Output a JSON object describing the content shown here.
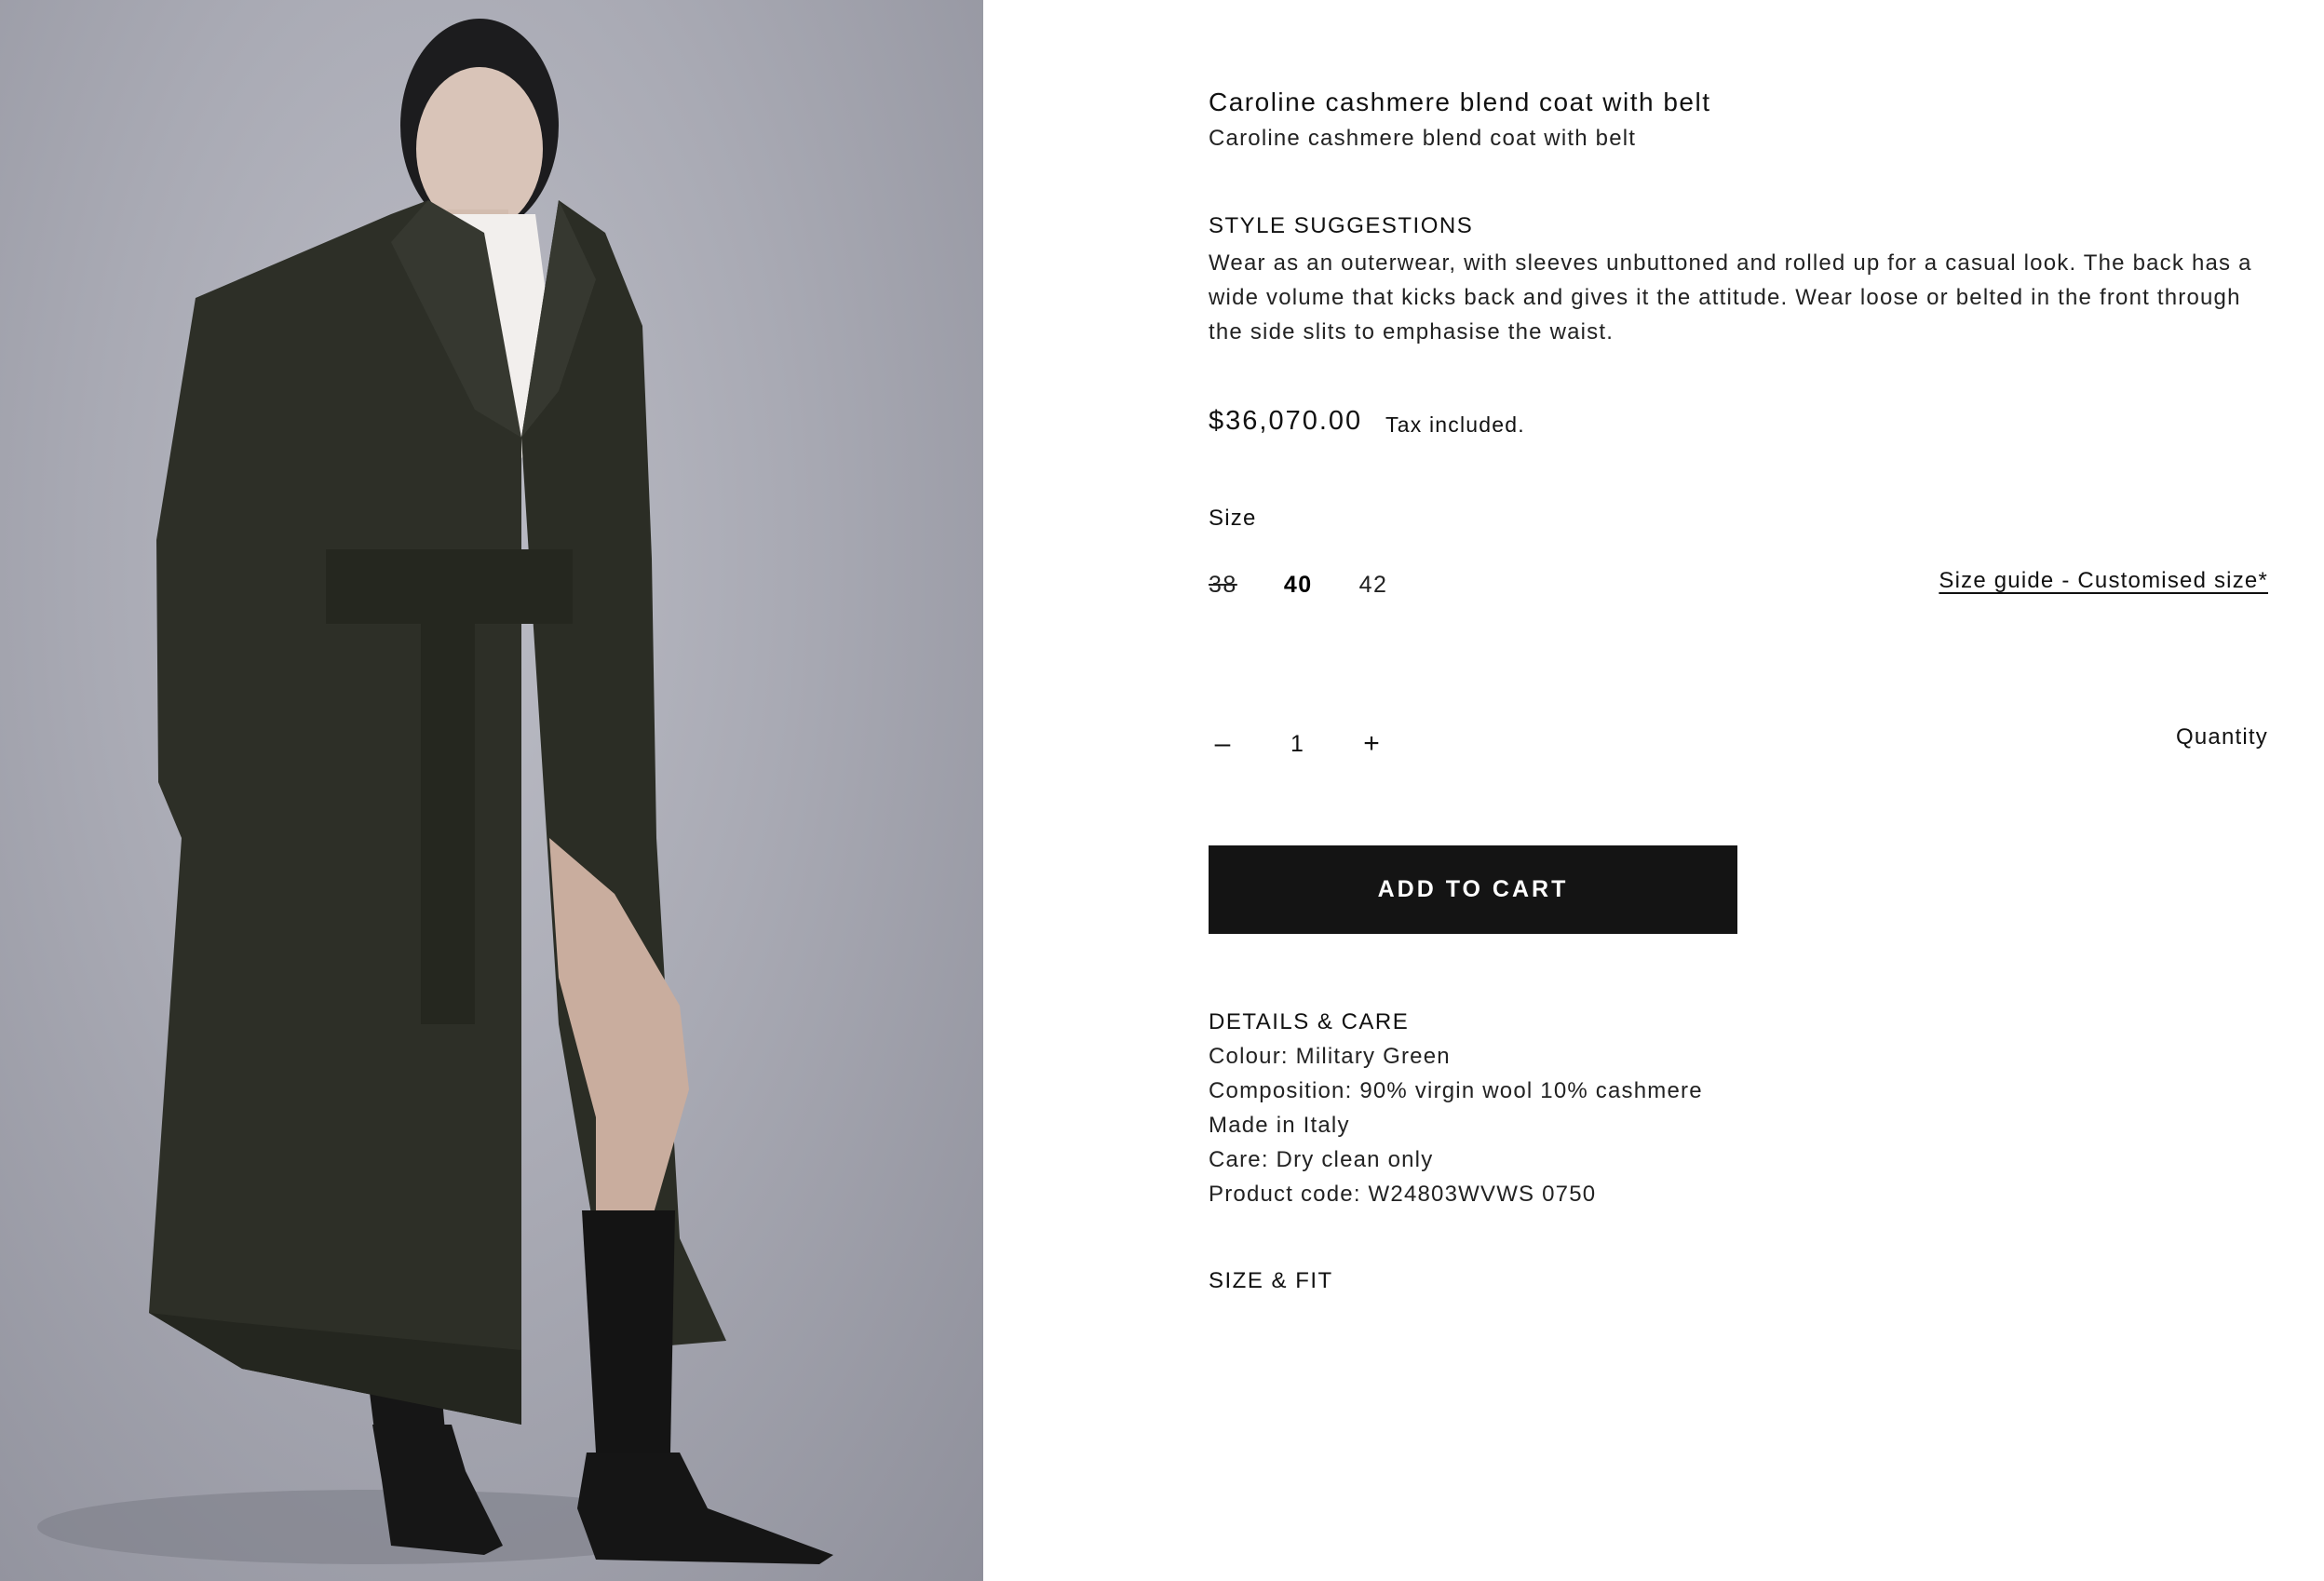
{
  "product": {
    "title": "Caroline cashmere blend coat with belt",
    "subtitle": "Caroline cashmere blend coat with belt"
  },
  "style_suggestions": {
    "heading": "STYLE SUGGESTIONS",
    "text": "Wear as an outerwear, with sleeves unbuttoned and rolled up for a casual look. The back has a wide volume that kicks back and gives it the attitude. Wear loose or belted in the front through the side slits to emphasise the waist."
  },
  "pricing": {
    "price": "$36,070.00",
    "tax_note": "Tax included."
  },
  "size": {
    "label": "Size",
    "options": [
      {
        "label": "38",
        "state": "unavailable"
      },
      {
        "label": "40",
        "state": "selected"
      },
      {
        "label": "42",
        "state": "available"
      }
    ],
    "guide_link": "Size guide - Customised size*"
  },
  "quantity": {
    "label": "Quantity",
    "value": "1",
    "decrement": "–",
    "increment": "+"
  },
  "cart": {
    "button_label": "ADD TO CART"
  },
  "details_care": {
    "heading": "DETAILS & CARE",
    "lines": [
      "Colour: Military Green",
      "Composition: 90% virgin wool 10% cashmere",
      "Made in Italy",
      "Care: Dry clean only",
      "Product code: W24803WVWS 0750"
    ]
  },
  "size_fit": {
    "heading": "SIZE & FIT"
  },
  "colors": {
    "button_bg": "#141414",
    "coat": "#2d2f27",
    "backdrop": "#a9aab4"
  }
}
